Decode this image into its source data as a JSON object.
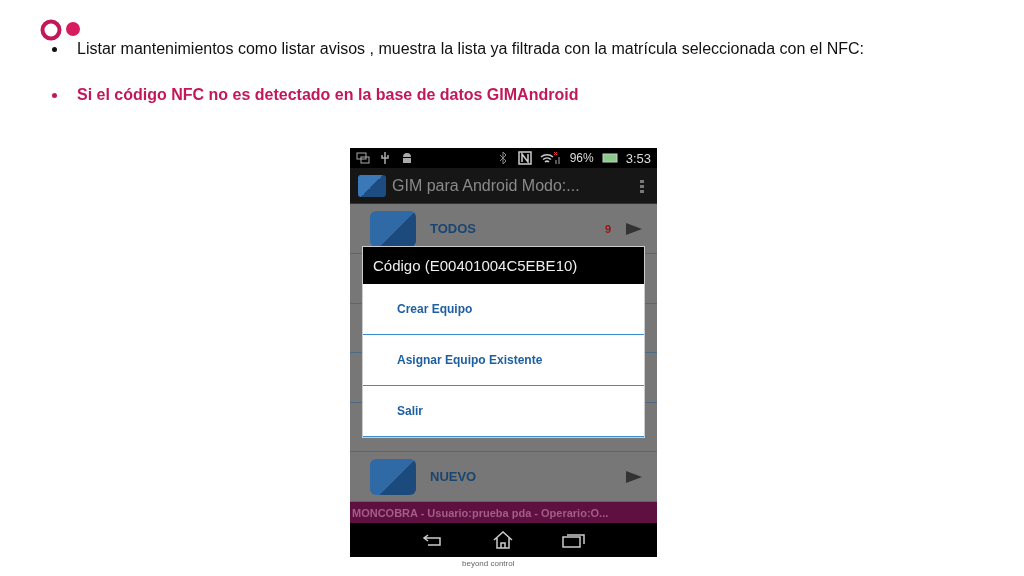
{
  "slide": {
    "bullets": [
      {
        "text": "Listar mantenimientos como listar avisos , muestra la lista ya filtrada con la matrícula seleccionada con el NFC:",
        "kind": "normal"
      },
      {
        "text": "Si el código NFC no es detectado en la base de datos GIMAndroid",
        "kind": "highlight"
      }
    ],
    "footer": "beyond control"
  },
  "phone": {
    "status_bar": {
      "battery": "96%",
      "time": "3:53"
    },
    "action_bar": {
      "title": "GIM para Android Modo:..."
    },
    "list": [
      {
        "label": "TODOS",
        "count": "9"
      },
      {
        "label": "NUEVO"
      }
    ],
    "dialog": {
      "title": "Código (E00401004C5EBE10)",
      "options": [
        "Crear Equipo",
        "Asignar Equipo Existente",
        "Salir"
      ]
    },
    "banner": "MONCOBRA  -  Usuario:prueba pda  -  Operario:O..."
  }
}
